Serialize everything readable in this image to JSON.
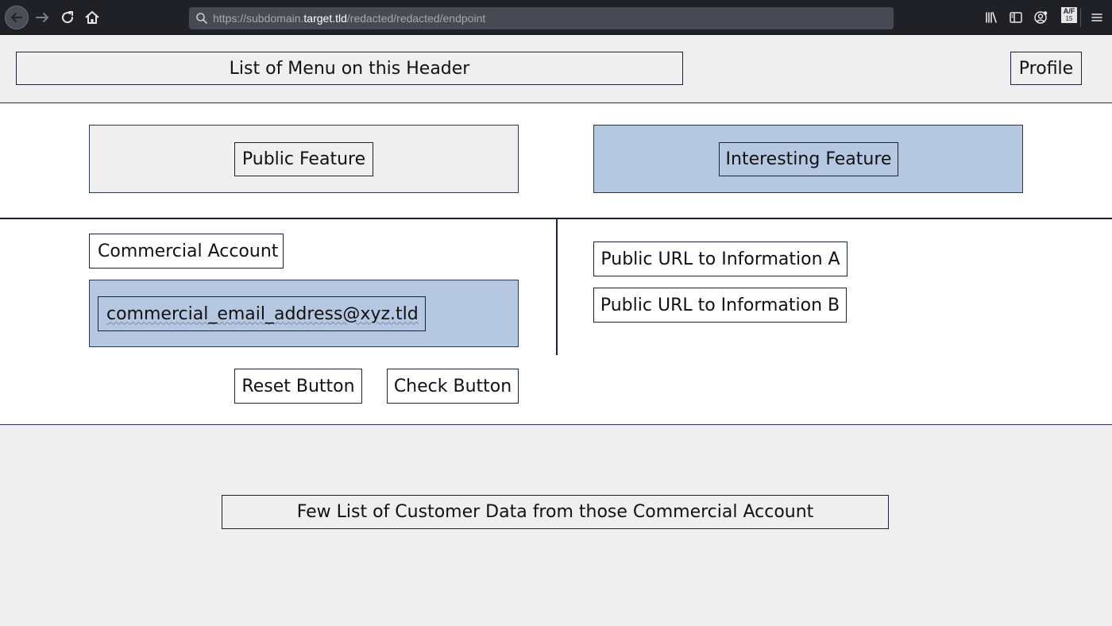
{
  "browser": {
    "url_prefix": "https://subdomain.",
    "url_domain": "target.tld",
    "url_path": "/redacted/redacted/endpoint",
    "addon_badge": "A/F",
    "addon_sub": "15"
  },
  "header": {
    "menu_label": "List of Menu on this Header",
    "profile_label": "Profile"
  },
  "features": {
    "public_label": "Public Feature",
    "interesting_label": "Interesting Feature"
  },
  "account": {
    "label": "Commercial Account",
    "email_value": "commercial_email_address@xyz.tld",
    "reset_label": "Reset Button",
    "check_label": "Check Button"
  },
  "links": {
    "info_a": "Public URL to Information A",
    "info_b": "Public URL to Information B"
  },
  "customer": {
    "data_label": "Few List of Customer Data from those Commercial Account"
  },
  "colors": {
    "chrome_bg": "#1f2127",
    "urlbar_bg": "#474a52",
    "panel_gray": "#efefef",
    "panel_blue": "#b6c7e1",
    "border": "#1b2236"
  },
  "icons": {
    "back": "arrow-left-icon",
    "forward": "arrow-right-icon",
    "reload": "reload-icon",
    "home": "home-icon",
    "search": "search-icon",
    "library": "library-icon",
    "sidebar": "sidebar-icon",
    "account": "account-icon",
    "addon": "addon-icon",
    "menu": "hamburger-menu-icon"
  }
}
